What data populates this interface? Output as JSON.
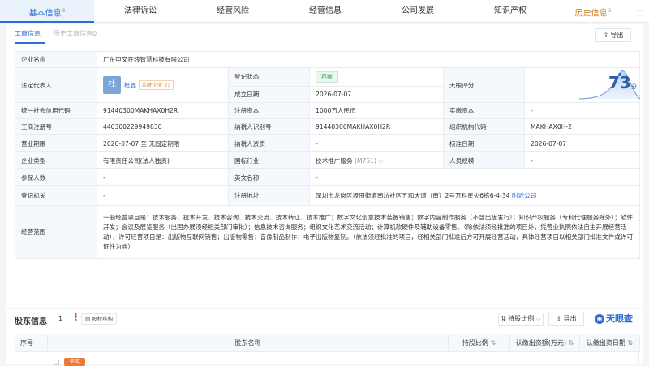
{
  "top_tabs": [
    {
      "label": "基本信息",
      "count": "8"
    },
    {
      "label": "法律诉讼",
      "count": ""
    },
    {
      "label": "经营风险",
      "count": ""
    },
    {
      "label": "经营信息",
      "count": ""
    },
    {
      "label": "公司发展",
      "count": ""
    },
    {
      "label": "知识产权",
      "count": ""
    },
    {
      "label": "历史信息",
      "count": "3"
    }
  ],
  "sub_tabs": {
    "active": "工商信息",
    "inactive": "历史工商信息",
    "inactive_count": "0",
    "export": "导出"
  },
  "info": {
    "company_name_label": "企业名称",
    "company_name": "广东中文在线智慧科技有限公司",
    "rep_label": "法定代表人",
    "rep_avatar": "杜",
    "rep_name": "杜鑫",
    "rep_rel": "关联企业 23",
    "reg_status_label": "登记状态",
    "reg_status": "存续",
    "score_label": "天眼评分",
    "score": "73",
    "score_unit": "分",
    "est_date_label": "成立日期",
    "est_date": "2026-07-07",
    "credit_code_label": "统一社会信用代码",
    "credit_code": "91440300MAKHAX0H2R",
    "reg_capital_label": "注册资本",
    "reg_capital": "1000万人民币",
    "paid_capital_label": "实缴资本",
    "paid_capital": "-",
    "reg_no_label": "工商注册号",
    "reg_no": "440300229949830",
    "taxpayer_id_label": "纳税人识别号",
    "taxpayer_id": "91440300MAKHAX0H2R",
    "org_code_label": "组织机构代码",
    "org_code": "MAKHAX0H-2",
    "term_label": "营业期限",
    "term": "2026-07-07 至 无固定期限",
    "taxpayer_qual_label": "纳税人资质",
    "taxpayer_qual": "-",
    "approve_date_label": "核准日期",
    "approve_date": "2026-07-07",
    "type_label": "企业类型",
    "type": "有限责任公司(法人独资)",
    "industry_label": "国标行业",
    "industry": "技术推广服务",
    "industry_code": "(M751)",
    "staff_label": "人员规模",
    "staff": "-",
    "insured_label": "参保人数",
    "insured": "-",
    "en_name_label": "英文名称",
    "en_name": "-",
    "authority_label": "登记机关",
    "authority": "-",
    "address_label": "注册地址",
    "address": "深圳市龙岗区坂田街道南坑社区五和大道（南）2号万科星火6栋6-4-34",
    "nearby": "附近公司",
    "scope_label": "经营范围",
    "scope": "一般经营项目是：技术服务、技术开发、技术咨询、技术交流、技术转让、技术推广；数字文化创意技术装备销售；数字内容制作服务（不含出版发行）；知识产权服务（专利代理服务除外）；软件开发；会议及展览服务（出国办展须经相关部门审批）；信息技术咨询服务；组织文化艺术交流活动；计算机软硬件及辅助设备零售。（除依法须经批准的项目外，凭营业执照依法自主开展经营活动），许可经营项目是：出版物互联网销售；出版物零售；音像制品制作；电子出版物复制。（依法须经批准的项目，经相关部门批准后方可开展经营活动，具体经营项目以相关部门批准文件或许可证件为准）"
  },
  "shareholders": {
    "title": "股东信息",
    "count": "1",
    "structure_btn": "股权结构",
    "ratio_btn": "持股比例",
    "export": "导出",
    "brand": "天眼查",
    "columns": [
      "序号",
      "股东名称",
      "持股比例",
      "认缴出资额(万元)",
      "认缴出资日期"
    ],
    "row_chip": "中文"
  },
  "colors": {
    "accent": "#2d6fd1",
    "status_green": "#3aa35c",
    "history_orange": "#d27b1e"
  }
}
